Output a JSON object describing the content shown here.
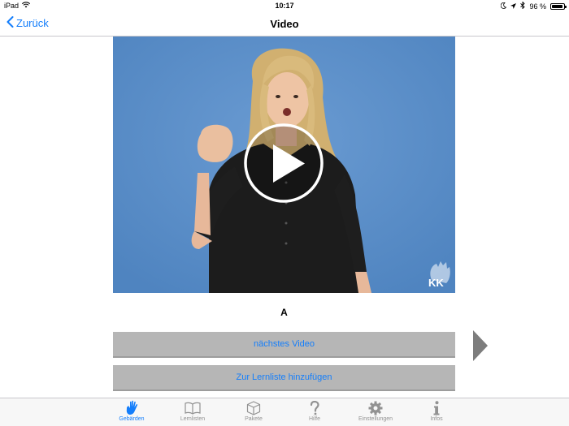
{
  "status_bar": {
    "device": "iPad",
    "time": "10:17",
    "battery_text": "96 %",
    "battery_level": 0.96
  },
  "nav": {
    "back_label": "Zurück",
    "title": "Video"
  },
  "video": {
    "background_color": "#5a8fc8",
    "watermark": "KK"
  },
  "label": "A",
  "buttons": {
    "next_video": "nächstes Video",
    "add_to_list": "Zur Lernliste hinzufügen"
  },
  "tabs": [
    {
      "label": "Gebärden",
      "icon": "hand-icon",
      "active": true
    },
    {
      "label": "Lernlisten",
      "icon": "book-icon",
      "active": false
    },
    {
      "label": "Pakete",
      "icon": "box-icon",
      "active": false
    },
    {
      "label": "Hilfe",
      "icon": "question-icon",
      "active": false
    },
    {
      "label": "Einstellungen",
      "icon": "gear-icon",
      "active": false
    },
    {
      "label": "Infos",
      "icon": "info-icon",
      "active": false
    }
  ],
  "colors": {
    "accent": "#147efb",
    "button_bg": "#b6b6b6",
    "inactive_tab": "#929292"
  }
}
